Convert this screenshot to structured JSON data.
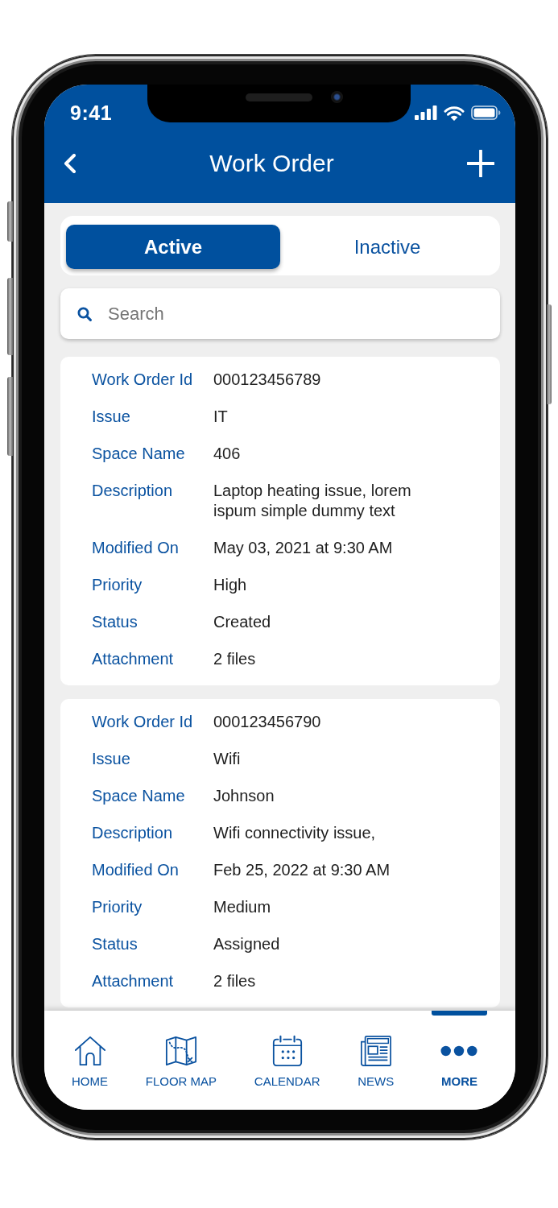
{
  "status_bar": {
    "time": "9:41"
  },
  "nav_bar": {
    "title": "Work Order"
  },
  "tabs": [
    {
      "label": "Active",
      "selected": true
    },
    {
      "label": "Inactive",
      "selected": false
    }
  ],
  "search": {
    "placeholder": "Search"
  },
  "work_orders": [
    {
      "fields": [
        {
          "label": "Work Order Id",
          "value": "000123456789"
        },
        {
          "label": "Issue",
          "value": "IT"
        },
        {
          "label": "Space Name",
          "value": "406"
        },
        {
          "label": "Description",
          "value": "Laptop heating issue, lorem ispum simple dummy text"
        },
        {
          "label": "Modified On",
          "value": "May 03, 2021 at 9:30 AM"
        },
        {
          "label": "Priority",
          "value": "High"
        },
        {
          "label": "Status",
          "value": "Created"
        },
        {
          "label": "Attachment",
          "value": "2 files"
        }
      ]
    },
    {
      "fields": [
        {
          "label": "Work Order Id",
          "value": "000123456790"
        },
        {
          "label": "Issue",
          "value": "Wifi"
        },
        {
          "label": "Space Name",
          "value": "Johnson"
        },
        {
          "label": "Description",
          "value": "Wifi connectivity issue,"
        },
        {
          "label": "Modified On",
          "value": "Feb 25, 2022 at 9:30 AM"
        },
        {
          "label": "Priority",
          "value": "Medium"
        },
        {
          "label": "Status",
          "value": "Assigned"
        },
        {
          "label": "Attachment",
          "value": "2 files"
        }
      ]
    }
  ],
  "bottom_nav": [
    {
      "label": "HOME",
      "selected": false
    },
    {
      "label": "FLOOR MAP",
      "selected": false
    },
    {
      "label": "CALENDAR",
      "selected": false
    },
    {
      "label": "NEWS",
      "selected": false
    },
    {
      "label": "MORE",
      "selected": true
    }
  ]
}
